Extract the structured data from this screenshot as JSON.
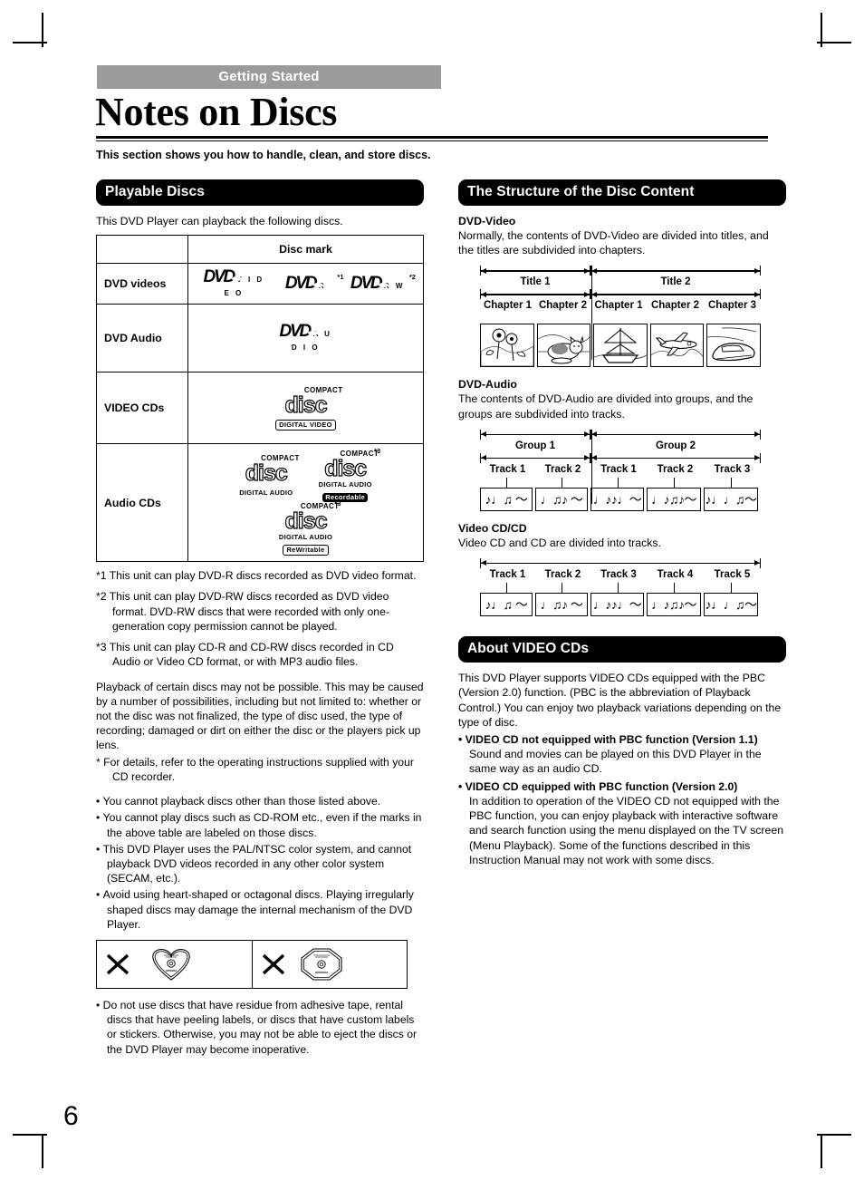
{
  "header": {
    "section_tag": "Getting Started",
    "title": "Notes on Discs",
    "subtitle": "This section shows you how to handle, clean, and store discs."
  },
  "page_number": "6",
  "left_column": {
    "band_title": "Playable Discs",
    "lead": "This DVD Player can playback the following discs.",
    "table": {
      "header_blank": "",
      "header_disc_mark": "Disc mark",
      "rows": [
        {
          "label": "DVD videos",
          "marks": [
            {
              "icon": "dvd-video-logo",
              "word": "DVD",
              "sub": "V I D E O",
              "note": ""
            },
            {
              "icon": "dvd-r-logo",
              "word": "DVD",
              "sub": "R",
              "note": "*1"
            },
            {
              "icon": "dvd-rw-logo",
              "word": "DVD",
              "sub": "R W",
              "note": "*2"
            }
          ]
        },
        {
          "label": "DVD Audio",
          "marks": [
            {
              "icon": "dvd-audio-logo",
              "word": "DVD",
              "sub": "A U D I O",
              "note": ""
            }
          ]
        },
        {
          "label": "VIDEO CDs",
          "marks": [
            {
              "icon": "compact-disc-digital-video-logo",
              "top": "COMPACT",
              "word": "disc",
              "band": "DIGITAL VIDEO",
              "band_style": "outline",
              "note": ""
            }
          ]
        },
        {
          "label": "Audio CDs",
          "marks": [
            {
              "icon": "compact-disc-digital-audio-logo",
              "top": "COMPACT",
              "word": "disc",
              "band": "DIGITAL AUDIO",
              "band_style": "plain",
              "note": ""
            },
            {
              "icon": "compact-disc-recordable-logo",
              "top": "COMPACT",
              "word": "disc",
              "band": "DIGITAL AUDIO",
              "band2": "Recordable",
              "band_style": "inverse",
              "note": "*3"
            },
            {
              "icon": "compact-disc-rewritable-logo",
              "top": "COMPACT",
              "word": "disc",
              "band": "DIGITAL AUDIO",
              "band2": "ReWritable",
              "band_style": "outline",
              "note": "*3"
            }
          ]
        }
      ]
    },
    "footnotes": [
      {
        "mark": "*1",
        "text": "This unit can play DVD-R discs recorded as DVD video format."
      },
      {
        "mark": "*2",
        "text": "This unit can play DVD-RW discs recorded as DVD video format. DVD-RW discs that were recorded with only one-generation copy permission cannot be played."
      },
      {
        "mark": "*3",
        "text": "This unit can play CD-R and CD-RW discs recorded in CD Audio or Video CD format, or with MP3 audio files."
      }
    ],
    "paragraph": "Playback of certain discs may not be possible. This may be caused by a number of possibilities, including but not limited to: whether or not the disc was not finalized, the type of disc used, the type of recording; damaged or dirt on either the disc or the players pick up lens.",
    "asterisk_note": {
      "mark": "*",
      "text": "For details, refer to the operating instructions supplied with your CD recorder."
    },
    "bullets": [
      "You cannot playback discs other than those listed above.",
      "You cannot play discs such as CD-ROM etc., even if the marks in the above table are labeled on those discs.",
      "This DVD Player uses the PAL/NTSC color system, and cannot playback DVD videos recorded in any other color system (SECAM, etc.).",
      "Avoid using heart-shaped or octagonal discs. Playing irregularly shaped discs may damage the internal mechanism of the DVD Player."
    ],
    "shape_warning": [
      {
        "x": "cross-mark-icon",
        "shape": "heart-shaped-disc-icon"
      },
      {
        "x": "cross-mark-icon",
        "shape": "octagonal-disc-icon"
      }
    ],
    "final_bullet": "Do not use discs that have residue from adhesive tape, rental discs that have peeling labels, or discs that have custom labels or stickers. Otherwise, you may not be able to eject the discs or the DVD Player may become inoperative."
  },
  "right_column": {
    "band_title": "The Structure of the Disc Content",
    "dvd_video": {
      "heading": "DVD-Video",
      "text": "Normally, the contents of DVD-Video are divided into titles, and the titles are subdivided into chapters.",
      "groups": [
        {
          "label": "Title 1",
          "items": [
            "Chapter 1",
            "Chapter 2"
          ]
        },
        {
          "label": "Title 2",
          "items": [
            "Chapter 1",
            "Chapter 2",
            "Chapter 3"
          ]
        }
      ],
      "thumbnails": [
        "flowers-thumbnail",
        "cat-thumbnail",
        "sailing-ship-thumbnail",
        "airplane-thumbnail",
        "car-thumbnail"
      ]
    },
    "dvd_audio": {
      "heading": "DVD-Audio",
      "text": "The contents of DVD-Audio are divided into groups, and the groups are subdivided into tracks.",
      "groups": [
        {
          "label": "Group 1",
          "items": [
            "Track 1",
            "Track 2"
          ]
        },
        {
          "label": "Group 2",
          "items": [
            "Track 1",
            "Track 2",
            "Track 3"
          ]
        }
      ],
      "note_glyphs": [
        "♪♩♫ ～",
        "♩♫♪ ～",
        "♩♪♪♩～",
        "♩♪♫♪～",
        "♪♩♩♫～"
      ]
    },
    "video_cd": {
      "heading": "Video CD/CD",
      "text": "Video CD and CD are divided into tracks.",
      "tracks": [
        "Track 1",
        "Track 2",
        "Track 3",
        "Track 4",
        "Track 5"
      ],
      "note_glyphs": [
        "♪♩♫ ～",
        "♩♫♪ ～",
        "♩♪♪♩～",
        "♩♪♫♪～",
        "♪♩♩♫～"
      ]
    },
    "about_band_title": "About VIDEO CDs",
    "about_intro": "This DVD Player supports VIDEO CDs equipped with the PBC (Version 2.0) function. (PBC is the abbreviation of Playback Control.) You can enjoy two playback variations depending on the type of disc.",
    "about_bullets": [
      {
        "title": "VIDEO CD not equipped with PBC function  (Version 1.1)",
        "body": "Sound and movies can be played on this DVD Player in the same way as an audio CD."
      },
      {
        "title": "VIDEO CD equipped with PBC function  (Version 2.0)",
        "body": "In addition to operation of the VIDEO CD not equipped with the PBC function, you can enjoy playback with interactive software and search function using the menu displayed on the TV screen (Menu Playback). Some of the functions described in this Instruction Manual may not work with some discs."
      }
    ]
  }
}
